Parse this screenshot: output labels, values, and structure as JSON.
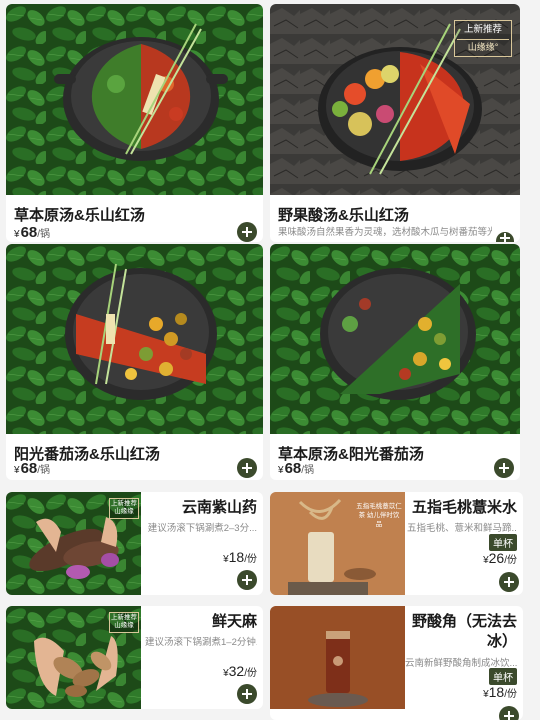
{
  "colors": {
    "accent": "#3b4a2c",
    "leaf": "#2c6b2a",
    "leaf_dark": "#1b4416"
  },
  "pot_cards": [
    {
      "title": "草本原汤&乐山红汤",
      "desc": "",
      "price": "68",
      "yen": "¥",
      "unit": "/锅",
      "add_icon": "plus-circle-icon"
    },
    {
      "title": "野果酸汤&乐山红汤",
      "desc": "果味酸汤自然果香为灵魂，选材酸木瓜与树番茄等光照充足的",
      "price": "",
      "yen": "",
      "unit": "",
      "add_icon": "plus-circle-icon",
      "badge": {
        "line1": "上新推荐",
        "logo": "山缘缘°"
      }
    },
    {
      "title": "阳光番茄汤&乐山红汤",
      "desc": "",
      "price": "68",
      "yen": "¥",
      "unit": "/锅",
      "add_icon": "plus-circle-icon"
    },
    {
      "title": "草本原汤&阳光番茄汤",
      "desc": "",
      "price": "68",
      "yen": "¥",
      "unit": "/锅",
      "add_icon": "plus-circle-icon"
    }
  ],
  "side_cards": [
    {
      "title": "云南紫山药",
      "desc": "建议汤滚下锅涮煮2–3分...",
      "price": "18",
      "yen": "¥",
      "unit": "/份",
      "badge": "上新推荐",
      "badge_logo": "山缘缘"
    },
    {
      "title": "五指毛桃薏米水",
      "desc": "五指毛桃、薏米和鲜马蹄...",
      "price": "26",
      "yen": "¥",
      "unit": "/份",
      "tag": "单杯",
      "poster": "五指毛桃薏苡仁茶 幼儿伴时饮品",
      "poster_line2": ""
    },
    {
      "title": "鲜天麻",
      "desc": "建议汤滚下锅涮煮1–2分钟...",
      "price": "32",
      "yen": "¥",
      "unit": "/份",
      "badge": "上新推荐",
      "badge_logo": "山缘缘"
    },
    {
      "title_line1": "野酸角（无法去",
      "title_line2": "冰）",
      "desc": "云南新鲜野酸角制成冰饮...",
      "price": "18",
      "yen": "¥",
      "unit": "/份",
      "tag": "单杯"
    }
  ]
}
